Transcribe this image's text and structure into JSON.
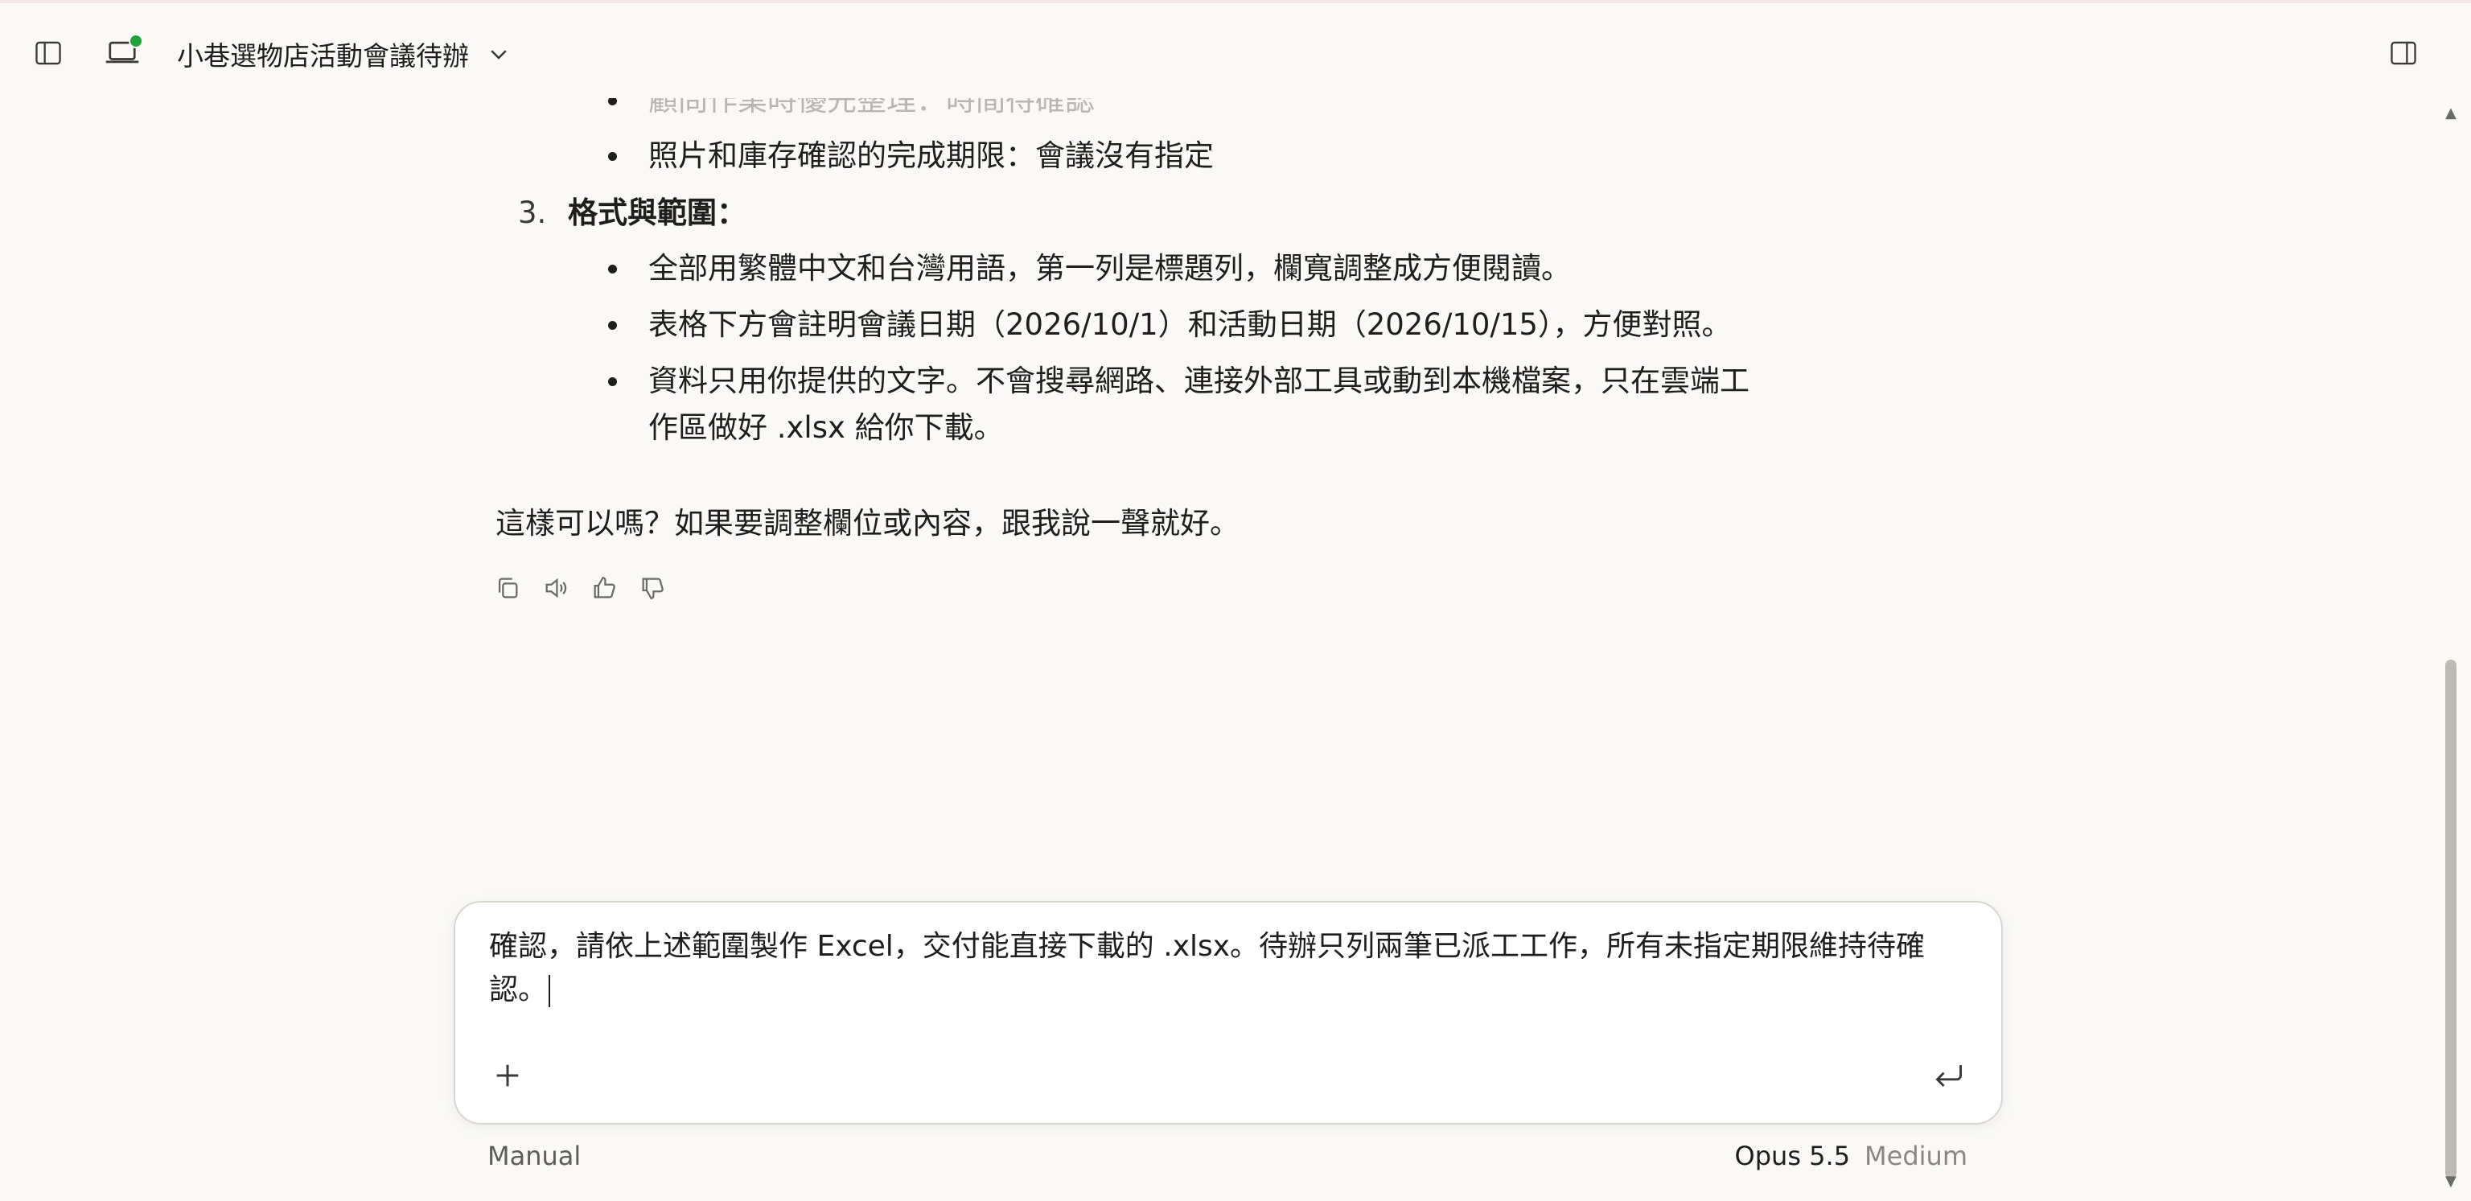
{
  "header": {
    "title": "小巷選物店活動會議待辦"
  },
  "message": {
    "faded_bullet": "顧問作業時優先整理：時間待確認",
    "bullets_section2": [
      "照片和庫存確認的完成期限：會議沒有指定"
    ],
    "section3_number": "3.",
    "section3_heading": "格式與範圍：",
    "bullets_section3": [
      "全部用繁體中文和台灣用語，第一列是標題列，欄寬調整成方便閱讀。",
      "表格下方會註明會議日期（2026/10/1）和活動日期（2026/10/15），方便對照。",
      "資料只用你提供的文字。不會搜尋網路、連接外部工具或動到本機檔案，只在雲端工",
      "作區做好 .xlsx 給你下載。"
    ],
    "closing": "這樣可以嗎？如果要調整欄位或內容，跟我說一聲就好。"
  },
  "composer": {
    "line1": "確認，請依上述範圍製作 Excel，交付能直接下載的 .xlsx。待辦只列兩筆已派工工作，所有未指定期限維持待確",
    "line2": "認。"
  },
  "footer": {
    "mode": "Manual",
    "model": "Opus 5.5",
    "effort": "Medium"
  },
  "colors": {
    "background": "#faf9f7",
    "status_dot": "#22a33a"
  }
}
